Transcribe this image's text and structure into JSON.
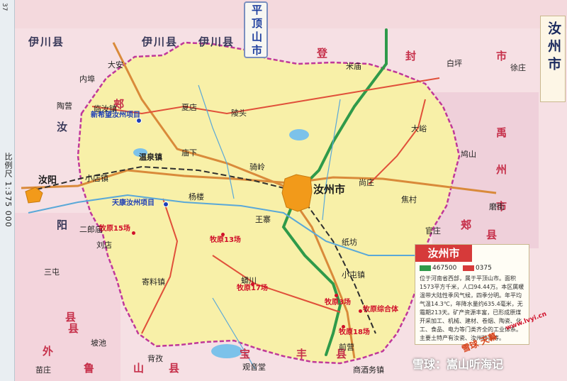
{
  "header": {
    "title": "平顶山市",
    "page_number": "37"
  },
  "side": {
    "city_name": "汝州市",
    "scale": "比例尺 1:375 000"
  },
  "infobox": {
    "title": "汝州市",
    "postal_code": "467500",
    "area_code": "0375",
    "text": "位于河南省西部，属于平顶山市。面积1573平方千米，人口94.44万。本区属暖温带大陆性季风气候，四季分明。年平均气温14.3℃，年降水量约635.4毫米，无霜期213天。矿产资源丰富，已形成原煤开采加工、机械、建材、卷烟、陶瓷、化工、食品、电力等门类齐全的工业体系。主要土特产有汝瓷、汝州粉条等。"
  },
  "colors": {
    "map_fill": "#f8f0a8",
    "neighbor_fill": "#f4d9dd",
    "river": "#5aa8d8",
    "road_main": "#d98a3a",
    "road_secondary": "#e0503a",
    "rail": "#2e2e2e",
    "highway": "#2f9a4a",
    "urban": "#f29a1a",
    "project_label": "#1f3fb6",
    "site_label": "#d0102a"
  },
  "neighbors": [
    {
      "text": "伊川县"
    },
    {
      "text": "伊川县"
    },
    {
      "text": "伊川县"
    },
    {
      "text": "汝"
    },
    {
      "text": "阳"
    },
    {
      "text": "郏"
    },
    {
      "text": "县"
    },
    {
      "text": "登"
    },
    {
      "text": "封"
    },
    {
      "text": "市"
    },
    {
      "text": "禹"
    },
    {
      "text": "州"
    },
    {
      "text": "市"
    },
    {
      "text": "郏"
    },
    {
      "text": "县"
    },
    {
      "text": "县"
    },
    {
      "text": "外"
    },
    {
      "text": "宝"
    },
    {
      "text": "丰"
    },
    {
      "text": "县"
    },
    {
      "text": "鲁"
    },
    {
      "text": "山"
    },
    {
      "text": "县"
    }
  ],
  "towns": [
    {
      "text": "汝州市",
      "major": true
    },
    {
      "text": "汝阳",
      "major": false
    },
    {
      "text": "大安"
    },
    {
      "text": "内埠"
    },
    {
      "text": "陶营"
    },
    {
      "text": "临汝镇"
    },
    {
      "text": "夏店"
    },
    {
      "text": "陵头"
    },
    {
      "text": "温泉镇"
    },
    {
      "text": "庙下"
    },
    {
      "text": "骑岭"
    },
    {
      "text": "小店镇"
    },
    {
      "text": "杨楼"
    },
    {
      "text": "王寨"
    },
    {
      "text": "尚庄"
    },
    {
      "text": "焦村"
    },
    {
      "text": "纸坊"
    },
    {
      "text": "刘店"
    },
    {
      "text": "三屯"
    },
    {
      "text": "寄料镇"
    },
    {
      "text": "蟒川"
    },
    {
      "text": "小屯镇"
    },
    {
      "text": "前营"
    },
    {
      "text": "背孜"
    },
    {
      "text": "观音堂"
    },
    {
      "text": "商酒务镇"
    },
    {
      "text": "白坪"
    },
    {
      "text": "徐庄"
    },
    {
      "text": "大峪"
    },
    {
      "text": "鸠山"
    },
    {
      "text": "磨街"
    },
    {
      "text": "米庙"
    },
    {
      "text": "官庄"
    },
    {
      "text": "二郎庙"
    },
    {
      "text": "坡池"
    },
    {
      "text": "苗庄"
    }
  ],
  "projects": [
    {
      "text": "新希望汝州项目"
    },
    {
      "text": "天康汝州项目"
    }
  ],
  "sites": [
    {
      "text": "牧原15场"
    },
    {
      "text": "牧原13场"
    },
    {
      "text": "牧原17场"
    },
    {
      "text": "牧原3场"
    },
    {
      "text": "牧原综合体"
    },
    {
      "text": "牧原18场"
    }
  ],
  "watermark": "雪球：嵩山听海记",
  "stamp": "雪球 天幕",
  "site_url": "www.lvyi.cn"
}
